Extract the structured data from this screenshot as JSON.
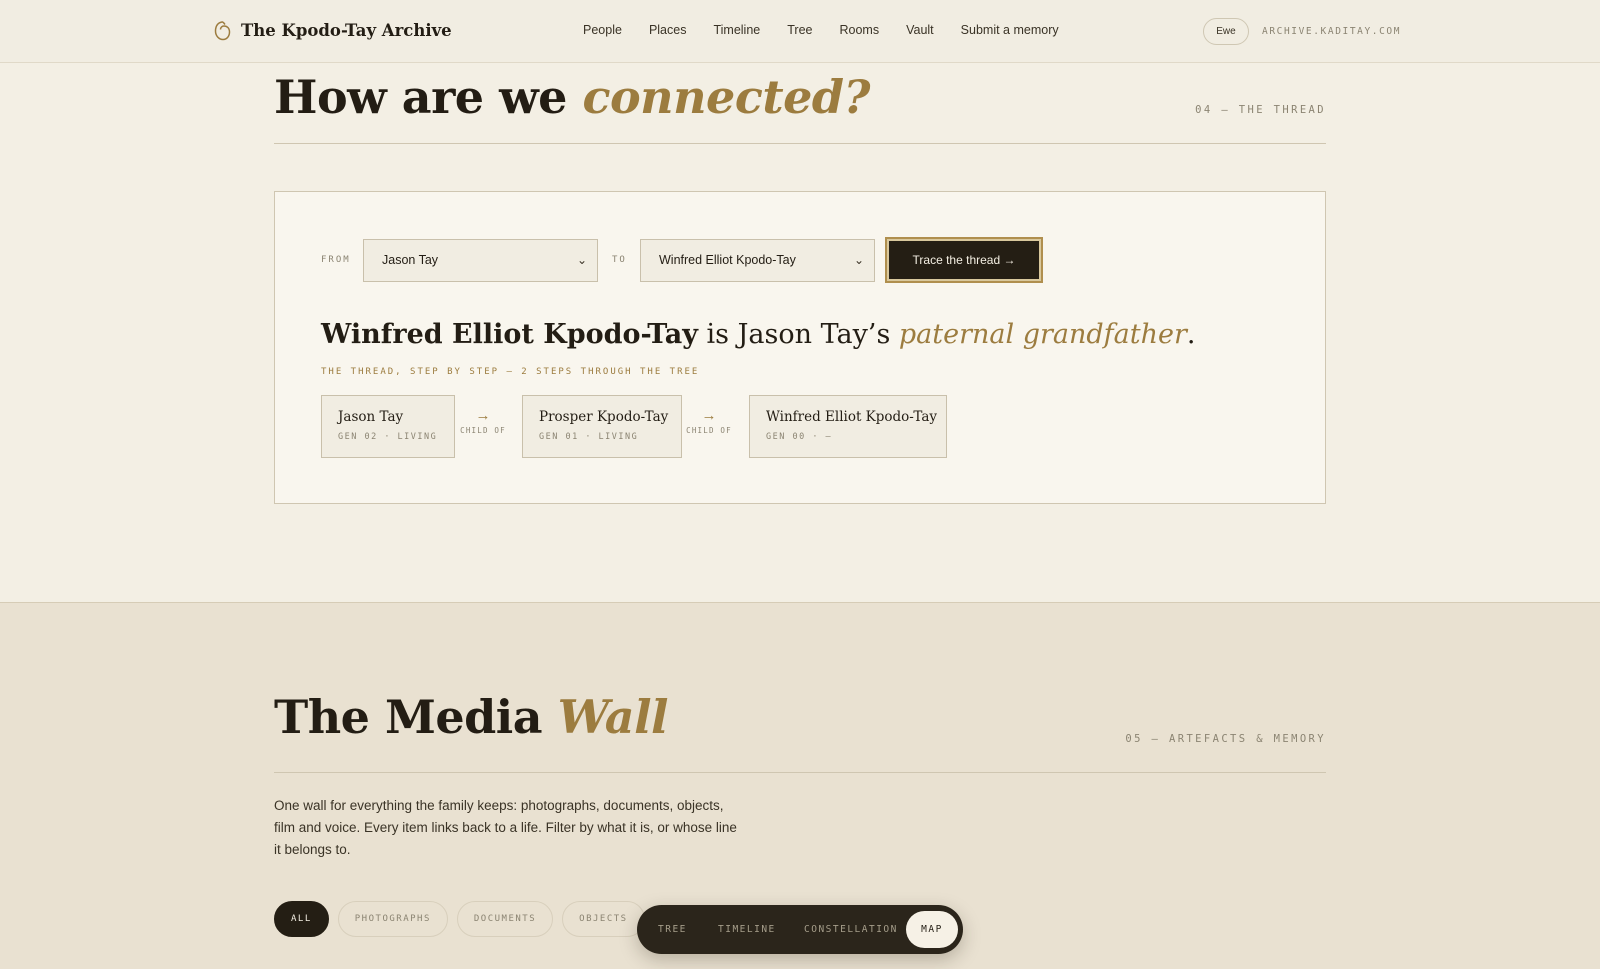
{
  "header": {
    "brand": "The Kpodo-Tay Archive",
    "nav": [
      "People",
      "Places",
      "Timeline",
      "Tree",
      "Rooms",
      "Vault",
      "Submit a memory"
    ],
    "lang": "Ewe",
    "domain": "ARCHIVE.KADITAY.COM"
  },
  "thread": {
    "title_plain": "How are we ",
    "title_em": "connected?",
    "section_num": "04 — THE THREAD",
    "from_label": "FROM",
    "from_value": "Jason Tay",
    "to_label": "TO",
    "to_value": "Winfred Elliot Kpodo-Tay",
    "button": "Trace the thread →",
    "result": {
      "subject": "Winfred Elliot Kpodo-Tay",
      "mid": " is Jason Tay’s ",
      "relation": "paternal grandfather",
      "end": "."
    },
    "steps_label": "THE THREAD, STEP BY STEP — 2 STEPS THROUGH THE TREE",
    "nodes": [
      {
        "name": "Jason Tay",
        "meta": "GEN 02 · LIVING"
      },
      {
        "name": "Prosper Kpodo-Tay",
        "meta": "GEN 01 · LIVING"
      },
      {
        "name": "Winfred Elliot Kpodo-Tay",
        "meta": "GEN 00 · —"
      }
    ],
    "connectors": [
      "CHILD OF",
      "CHILD OF"
    ]
  },
  "media": {
    "title_plain": "The Media ",
    "title_em": "Wall",
    "section_num": "05 — ARTEFACTS & MEMORY",
    "intro": "One wall for everything the family keeps: photographs, documents, objects, film and voice. Every item links back to a life. Filter by what it is, or whose line it belongs to.",
    "filters": [
      "ALL",
      "PHOTOGRAPHS",
      "DOCUMENTS",
      "OBJECTS"
    ]
  },
  "switcher": [
    "TREE",
    "TIMELINE",
    "CONSTELLATION",
    "MAP"
  ],
  "colors": {
    "accent": "#9c7c3f",
    "dark": "#241e14",
    "paper": "#f3efe4"
  }
}
